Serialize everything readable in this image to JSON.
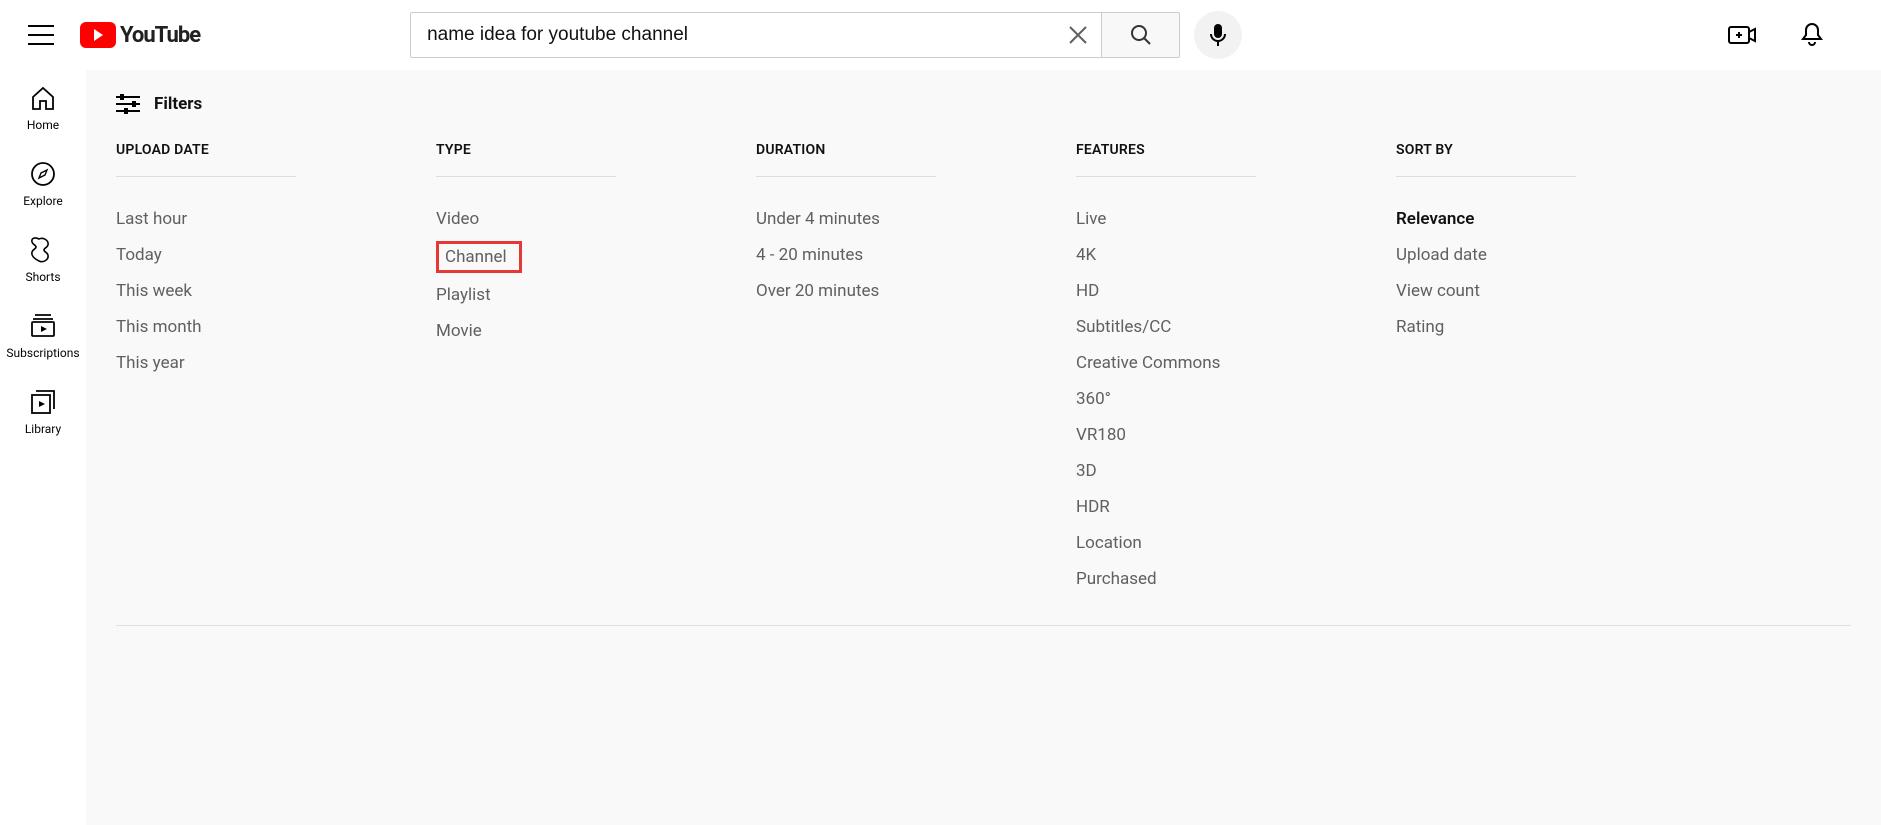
{
  "header": {
    "brand": "YouTube",
    "search_value": "name idea for youtube channel"
  },
  "sidebar": {
    "items": [
      {
        "label": "Home"
      },
      {
        "label": "Explore"
      },
      {
        "label": "Shorts"
      },
      {
        "label": "Subscriptions"
      },
      {
        "label": "Library"
      }
    ]
  },
  "filters": {
    "title": "Filters",
    "columns": [
      {
        "heading": "UPLOAD DATE",
        "options": [
          "Last hour",
          "Today",
          "This week",
          "This month",
          "This year"
        ]
      },
      {
        "heading": "TYPE",
        "options": [
          "Video",
          "Channel",
          "Playlist",
          "Movie"
        ],
        "highlighted": "Channel"
      },
      {
        "heading": "DURATION",
        "options": [
          "Under 4 minutes",
          "4 - 20 minutes",
          "Over 20 minutes"
        ]
      },
      {
        "heading": "FEATURES",
        "options": [
          "Live",
          "4K",
          "HD",
          "Subtitles/CC",
          "Creative Commons",
          "360°",
          "VR180",
          "3D",
          "HDR",
          "Location",
          "Purchased"
        ]
      },
      {
        "heading": "SORT BY",
        "options": [
          "Relevance",
          "Upload date",
          "View count",
          "Rating"
        ],
        "selected": "Relevance"
      }
    ]
  }
}
